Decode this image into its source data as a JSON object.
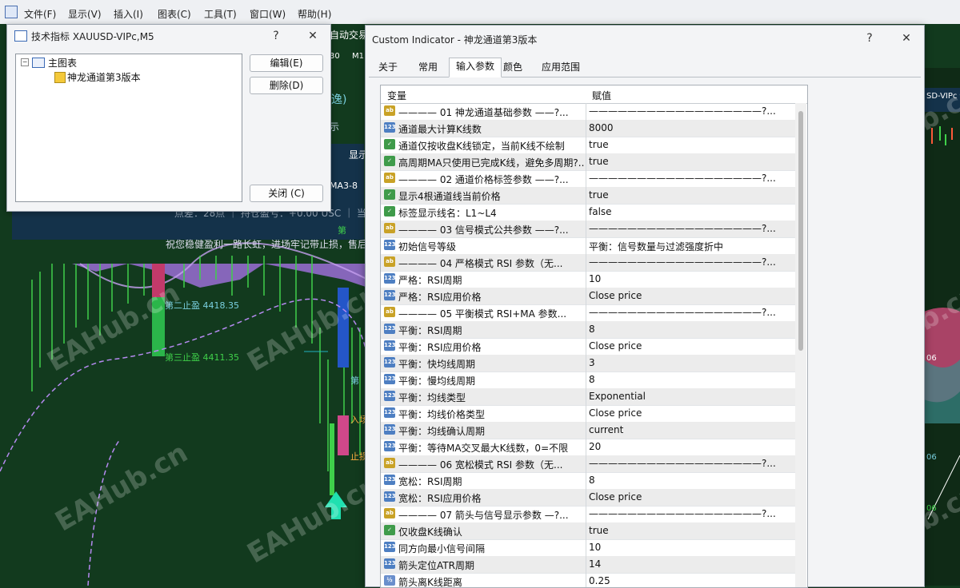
{
  "menubar": {
    "items": [
      "文件(F)",
      "显示(V)",
      "插入(I)",
      "图表(C)",
      "工具(T)",
      "窗口(W)",
      "帮助(H)"
    ]
  },
  "chart_bg": {
    "texts": {
      "auto_trade": "自动交易",
      "tf": "30",
      "m1": "M1",
      "display": "显示",
      "ma3": "MA3-8",
      "status": "点差：28点 ｜ 持仓盈亏：+0.00 USC ｜ 当",
      "wish": "祝您稳健盈利一路长虹，进场牢记带止损，售后",
      "tp2": "第二止盈  4418.35",
      "tp3": "第三止盈  4411.35",
      "symbol": "SD-VIPc",
      "r1": "06",
      "r2": "06",
      "r3": "06",
      "escape": "逸)",
      "shi": "示",
      "enter": "入场",
      "stop": "止损",
      "di": "第",
      "di2": "第"
    },
    "watermark": "EAHub.cn"
  },
  "dialog_indicators": {
    "title": "技术指标 XAUUSD-VIPc,M5",
    "help": "?",
    "close": "✕",
    "tree_root": "主图表",
    "tree_child": "神龙通道第3版本",
    "edit_label": "编辑(E)",
    "delete_label": "删除(D)",
    "close_label": "关闭 (C)"
  },
  "dialog_custom": {
    "title": "Custom Indicator - 神龙通道第3版本",
    "help": "?",
    "close": "✕",
    "tabs": [
      "关于",
      "常用",
      "输入参数",
      "颜色",
      "应用范围"
    ],
    "active_tab": 2,
    "col_var": "变量",
    "col_val": "赋值",
    "rows": [
      {
        "type": "str",
        "icon": "ab",
        "name": "———— 01 神龙通道基础参数 ——?...",
        "value": "——————————————————?..."
      },
      {
        "type": "int",
        "icon": "123",
        "name": "通道最大计算K线数",
        "value": "8000"
      },
      {
        "type": "bool",
        "icon": "✓",
        "name": "通道仅按收盘K线锁定，当前K线不绘制",
        "value": "true"
      },
      {
        "type": "bool",
        "icon": "✓",
        "name": "高周期MA只使用已完成K线，避免多周期?...",
        "value": "true"
      },
      {
        "type": "str",
        "icon": "ab",
        "name": "———— 02 通道价格标签参数 ——?...",
        "value": "——————————————————?..."
      },
      {
        "type": "bool",
        "icon": "✓",
        "name": "显示4根通道线当前价格",
        "value": "true"
      },
      {
        "type": "bool",
        "icon": "✓",
        "name": "标签显示线名：L1~L4",
        "value": "false"
      },
      {
        "type": "str",
        "icon": "ab",
        "name": "———— 03 信号模式公共参数 ——?...",
        "value": "——————————————————?..."
      },
      {
        "type": "int",
        "icon": "123",
        "name": "初始信号等级",
        "value": "平衡：信号数量与过滤强度折中"
      },
      {
        "type": "str",
        "icon": "ab",
        "name": "———— 04 严格模式 RSI 参数（无...",
        "value": "——————————————————?..."
      },
      {
        "type": "int",
        "icon": "123",
        "name": "严格：RSI周期",
        "value": "10"
      },
      {
        "type": "int",
        "icon": "123",
        "name": "严格：RSI应用价格",
        "value": "Close price"
      },
      {
        "type": "str",
        "icon": "ab",
        "name": "———— 05 平衡模式 RSI+MA 参数...",
        "value": "——————————————————?..."
      },
      {
        "type": "int",
        "icon": "123",
        "name": "平衡：RSI周期",
        "value": "8"
      },
      {
        "type": "int",
        "icon": "123",
        "name": "平衡：RSI应用价格",
        "value": "Close price"
      },
      {
        "type": "int",
        "icon": "123",
        "name": "平衡：快均线周期",
        "value": "3"
      },
      {
        "type": "int",
        "icon": "123",
        "name": "平衡：慢均线周期",
        "value": "8"
      },
      {
        "type": "int",
        "icon": "123",
        "name": "平衡：均线类型",
        "value": "Exponential"
      },
      {
        "type": "int",
        "icon": "123",
        "name": "平衡：均线价格类型",
        "value": "Close price"
      },
      {
        "type": "int",
        "icon": "123",
        "name": "平衡：均线确认周期",
        "value": "current"
      },
      {
        "type": "int",
        "icon": "123",
        "name": "平衡：等待MA交叉最大K线数，0=不限",
        "value": "20"
      },
      {
        "type": "str",
        "icon": "ab",
        "name": "———— 06 宽松模式 RSI 参数（无...",
        "value": "——————————————————?..."
      },
      {
        "type": "int",
        "icon": "123",
        "name": "宽松：RSI周期",
        "value": "8"
      },
      {
        "type": "int",
        "icon": "123",
        "name": "宽松：RSI应用价格",
        "value": "Close price"
      },
      {
        "type": "str",
        "icon": "ab",
        "name": "———— 07 箭头与信号显示参数 —?...",
        "value": "——————————————————?..."
      },
      {
        "type": "bool",
        "icon": "✓",
        "name": "仅收盘K线确认",
        "value": "true"
      },
      {
        "type": "int",
        "icon": "123",
        "name": "同方向最小信号间隔",
        "value": "10"
      },
      {
        "type": "int",
        "icon": "123",
        "name": "箭头定位ATR周期",
        "value": "14"
      },
      {
        "type": "dbl",
        "icon": "½",
        "name": "箭头离K线距离",
        "value": "0.25"
      }
    ]
  },
  "colors": {
    "chart_bg": "#123a1e",
    "dialog_bg": "#f3f4f6",
    "arrow": "#20e0b0"
  }
}
